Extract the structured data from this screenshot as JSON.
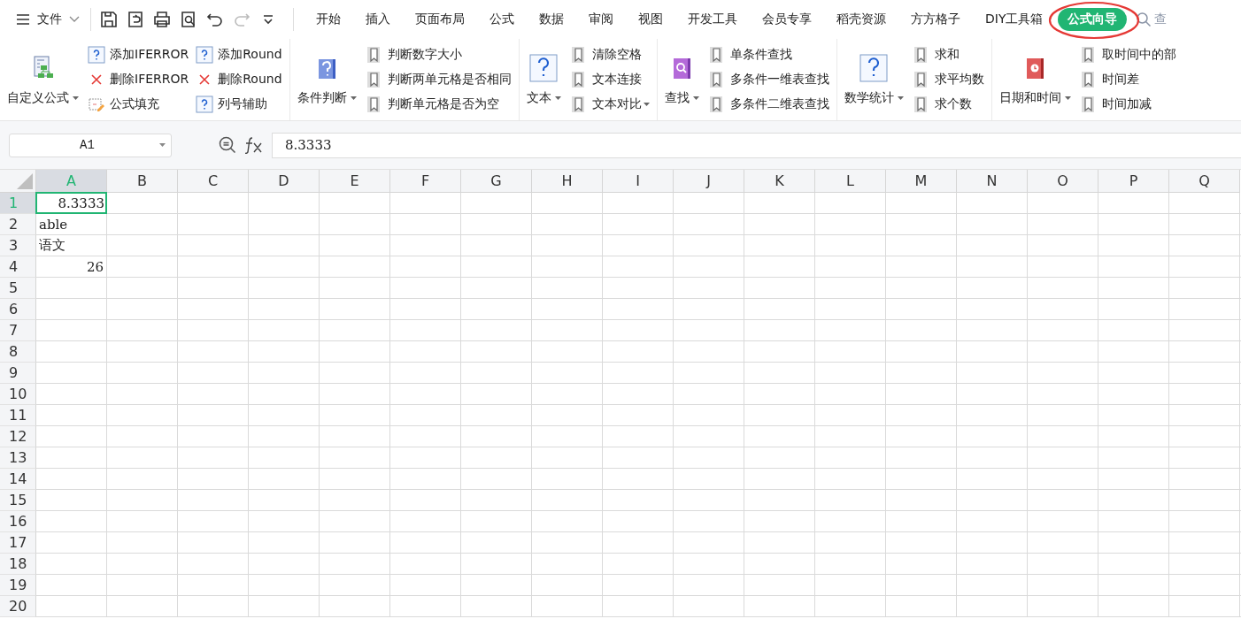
{
  "menu": {
    "label": "文件"
  },
  "quick_tools": [
    {
      "kind": "save",
      "disabled": false
    },
    {
      "kind": "export",
      "disabled": false
    },
    {
      "kind": "print",
      "disabled": false
    },
    {
      "kind": "preview",
      "disabled": false
    },
    {
      "kind": "undo",
      "disabled": false
    },
    {
      "kind": "redo",
      "disabled": true
    },
    {
      "kind": "more",
      "disabled": false
    }
  ],
  "tabs": [
    {
      "label": "开始",
      "selected": false,
      "annotated": false
    },
    {
      "label": "插入",
      "selected": false,
      "annotated": false
    },
    {
      "label": "页面布局",
      "selected": false,
      "annotated": false
    },
    {
      "label": "公式",
      "selected": false,
      "annotated": false
    },
    {
      "label": "数据",
      "selected": false,
      "annotated": false
    },
    {
      "label": "审阅",
      "selected": false,
      "annotated": false
    },
    {
      "label": "视图",
      "selected": false,
      "annotated": false
    },
    {
      "label": "开发工具",
      "selected": false,
      "annotated": false
    },
    {
      "label": "会员专享",
      "selected": false,
      "annotated": false
    },
    {
      "label": "稻壳资源",
      "selected": false,
      "annotated": false
    },
    {
      "label": "方方格子",
      "selected": false,
      "annotated": false
    },
    {
      "label": "DIY工具箱",
      "selected": false,
      "annotated": false
    },
    {
      "label": "公式向导",
      "selected": true,
      "annotated": true
    }
  ],
  "search": {
    "label": "查"
  },
  "ribbon": [
    {
      "label": "自定义公式",
      "kind": "custom",
      "dropdown": true,
      "columns": [
        [
          {
            "label": "添加IFERROR",
            "kind": "help",
            "dropdown": false
          },
          {
            "label": "删除IFERROR",
            "kind": "delete",
            "dropdown": false
          },
          {
            "label": "公式填充",
            "kind": "fill",
            "dropdown": false
          }
        ],
        [
          {
            "label": "添加Round",
            "kind": "help",
            "dropdown": false
          },
          {
            "label": "删除Round",
            "kind": "delete",
            "dropdown": false
          },
          {
            "label": "列号辅助",
            "kind": "help",
            "dropdown": false
          }
        ]
      ]
    },
    {
      "label": "条件判断",
      "kind": "condition",
      "dropdown": true,
      "columns": [
        [
          {
            "label": "判断数字大小",
            "kind": "bookmark",
            "dropdown": false
          },
          {
            "label": "判断两单元格是否相同",
            "kind": "bookmark",
            "dropdown": false
          },
          {
            "label": "判断单元格是否为空",
            "kind": "bookmark",
            "dropdown": false
          }
        ]
      ]
    },
    {
      "label": "文本",
      "kind": "text",
      "dropdown": true,
      "columns": [
        [
          {
            "label": "清除空格",
            "kind": "bookmark",
            "dropdown": false
          },
          {
            "label": "文本连接",
            "kind": "bookmark",
            "dropdown": false
          },
          {
            "label": "文本对比",
            "kind": "bookmark",
            "dropdown": true
          }
        ]
      ]
    },
    {
      "label": "查找",
      "kind": "lookup",
      "dropdown": true,
      "columns": [
        [
          {
            "label": "单条件查找",
            "kind": "bookmark",
            "dropdown": false
          },
          {
            "label": "多条件一维表查找",
            "kind": "bookmark",
            "dropdown": false
          },
          {
            "label": "多条件二维表查找",
            "kind": "bookmark",
            "dropdown": false
          }
        ]
      ]
    },
    {
      "label": "数学统计",
      "kind": "text",
      "dropdown": true,
      "columns": [
        [
          {
            "label": "求和",
            "kind": "bookmark",
            "dropdown": false
          },
          {
            "label": "求平均数",
            "kind": "bookmark",
            "dropdown": false
          },
          {
            "label": "求个数",
            "kind": "bookmark",
            "dropdown": false
          }
        ]
      ]
    },
    {
      "label": "日期和时间",
      "kind": "date",
      "dropdown": true,
      "columns": [
        [
          {
            "label": "取时间中的部",
            "kind": "bookmark",
            "dropdown": false
          },
          {
            "label": "时间差",
            "kind": "bookmark",
            "dropdown": false
          },
          {
            "label": "时间加减",
            "kind": "bookmark",
            "dropdown": false
          }
        ]
      ]
    }
  ],
  "name_box": {
    "value": "A1"
  },
  "formula": {
    "value": "8.3333"
  },
  "sheet": {
    "columns": [
      {
        "label": "A",
        "selected": true
      },
      {
        "label": "B",
        "selected": false
      },
      {
        "label": "C",
        "selected": false
      },
      {
        "label": "D",
        "selected": false
      },
      {
        "label": "E",
        "selected": false
      },
      {
        "label": "F",
        "selected": false
      },
      {
        "label": "G",
        "selected": false
      },
      {
        "label": "H",
        "selected": false
      },
      {
        "label": "I",
        "selected": false
      },
      {
        "label": "J",
        "selected": false
      },
      {
        "label": "K",
        "selected": false
      },
      {
        "label": "L",
        "selected": false
      },
      {
        "label": "M",
        "selected": false
      },
      {
        "label": "N",
        "selected": false
      },
      {
        "label": "O",
        "selected": false
      },
      {
        "label": "P",
        "selected": false
      },
      {
        "label": "Q",
        "selected": false
      }
    ],
    "rows": [
      {
        "label": "1",
        "selected": true,
        "cells": [
          {
            "text": "8.3333",
            "kind": "number",
            "selected": true
          }
        ]
      },
      {
        "label": "2",
        "selected": false,
        "cells": [
          {
            "text": "able",
            "kind": "text",
            "selected": false
          }
        ]
      },
      {
        "label": "3",
        "selected": false,
        "cells": [
          {
            "text": "语文",
            "kind": "text",
            "selected": false
          }
        ]
      },
      {
        "label": "4",
        "selected": false,
        "cells": [
          {
            "text": "26",
            "kind": "number",
            "selected": false
          }
        ]
      },
      {
        "label": "5",
        "selected": false
      },
      {
        "label": "6",
        "selected": false
      },
      {
        "label": "7",
        "selected": false
      },
      {
        "label": "8",
        "selected": false
      },
      {
        "label": "9",
        "selected": false
      },
      {
        "label": "10",
        "selected": false
      },
      {
        "label": "11",
        "selected": false
      },
      {
        "label": "12",
        "selected": false
      },
      {
        "label": "13",
        "selected": false
      },
      {
        "label": "14",
        "selected": false
      },
      {
        "label": "15",
        "selected": false
      },
      {
        "label": "16",
        "selected": false
      },
      {
        "label": "17",
        "selected": false
      },
      {
        "label": "18",
        "selected": false
      },
      {
        "label": "19",
        "selected": false
      },
      {
        "label": "20",
        "selected": false
      }
    ]
  }
}
